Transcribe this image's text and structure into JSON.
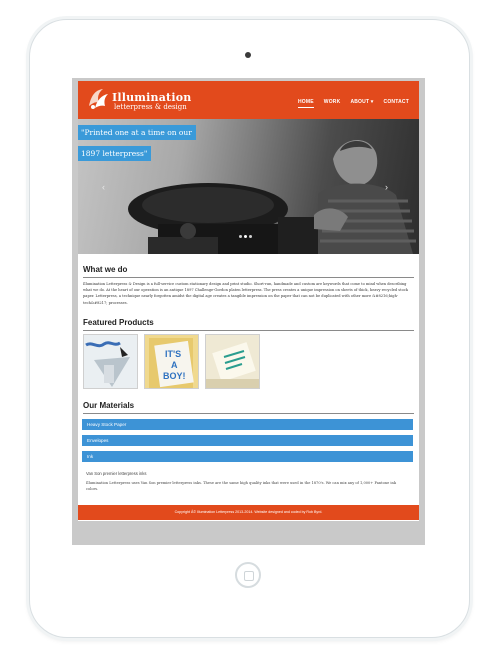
{
  "site": {
    "logo_title": "Illumination",
    "logo_subtitle": "letterpress & design",
    "nav": [
      {
        "label": "HOME"
      },
      {
        "label": "WORK"
      },
      {
        "label": "ABOUT ▾"
      },
      {
        "label": "CONTACT"
      }
    ],
    "hero": {
      "caption_line1": "\"Printed one at a time on our",
      "caption_line2": "1897 letterpress\"",
      "prev": "‹",
      "next": "›"
    },
    "what_we_do": {
      "heading": "What we do",
      "body": "Illumination Letterpress & Design is a full-service custom stationary design and print studio. Short-run, handmade and custom are keywords that come to mind when describing what we do. At the heart of our operation is an antique 1897 Challenge-Gordon platen letterpress. The press creates a unique impression on sheets of thick, heavy recycled stock paper. Letterpress, a technique nearly forgotten amidst the digital age creates a tangible impression on the paper that can not be duplicated with other more &#8216;high-tech&#8217; processes."
    },
    "featured": {
      "heading": "Featured Products",
      "products": [
        {
          "alt": "Handmade print"
        },
        {
          "alt": "It's a boy"
        },
        {
          "alt": "Letterpress card"
        }
      ],
      "product_texts": [
        "IT'S",
        "A",
        "BOY!"
      ]
    },
    "materials": {
      "heading": "Our Materials",
      "items": [
        {
          "label": "Heavy Stock Paper"
        },
        {
          "label": "Envelopes"
        },
        {
          "label": "Ink"
        }
      ],
      "ink_title": "Van Son premier letterpress inks",
      "ink_body": "Illumination Letterpress uses Van Son premier letterpress inks. These are the same high quality inks that were used in the 1870's. We can mix any of 1,000+ Pantone ink colors."
    },
    "footer": "Copyright Â© Illumination Letterpress 2013-2014. Website designed and coded by Rob Byrd."
  },
  "colors": {
    "brand_orange": "#e24a1c",
    "accent_blue": "#3d93d6"
  }
}
